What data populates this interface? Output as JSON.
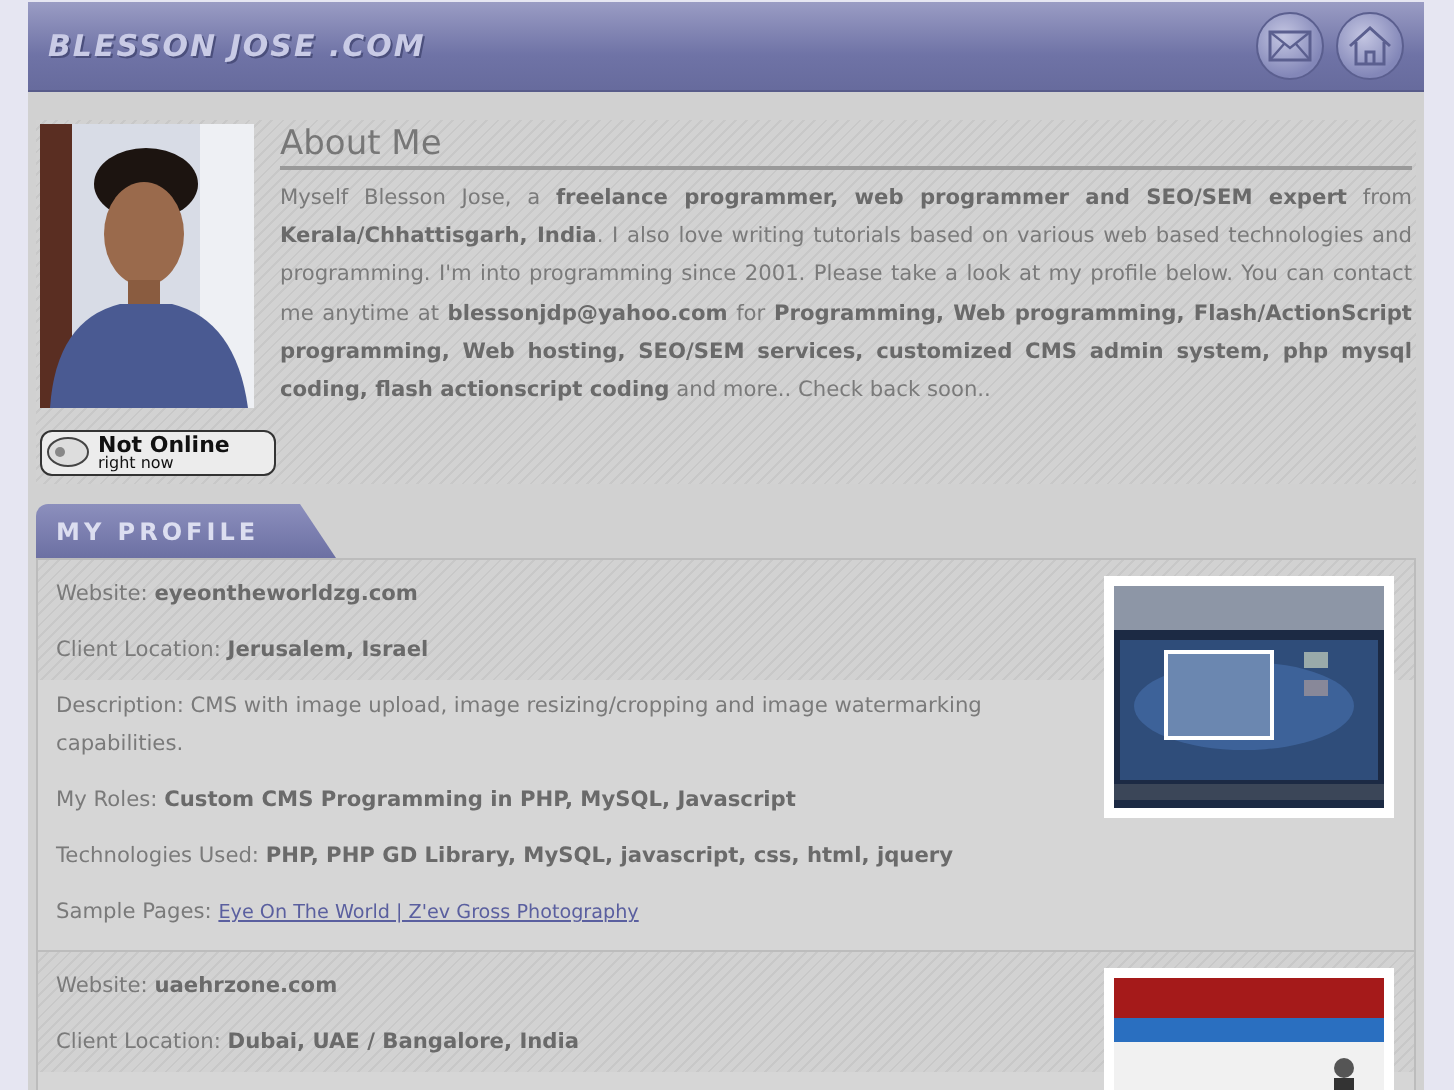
{
  "header": {
    "logo": "BLESSON JOSE .COM",
    "buttons": [
      {
        "kind": "mail"
      },
      {
        "kind": "home"
      }
    ]
  },
  "about": {
    "status": {
      "title": "Not Online",
      "subtitle": "right now"
    },
    "title": "About Me",
    "text": "Myself Blesson Jose, a **freelance programmer, web programmer and SEO/SEM expert** from **Kerala/Chhattisgarh, India**. I also love writing tutorials based on various web based technologies and programming. I'm into programming since 2001. Please take a look at my profile below. You can contact me anytime at **blessonjdp@yahoo.com** for **Programming, Web programming, Flash/ActionScript programming, Web hosting, SEO/SEM services, customized CMS admin system, php mysql coding, flash actionscript coding** and more.. Check back soon.."
  },
  "profile": {
    "title": "MY PROFILE",
    "projects": [
      {
        "rows": [
          {
            "label": "Website:",
            "value": "eyeontheworldzg.com"
          },
          {
            "label": "Client Location:",
            "value": "Jerusalem, Israel"
          },
          {
            "label": "Description:",
            "text": "CMS with image upload, image resizing/cropping and image watermarking capabilities."
          },
          {
            "label": "My Roles:",
            "value": "Custom CMS Programming in PHP, MySQL, Javascript"
          },
          {
            "label": "Technologies Used:",
            "value": "PHP, PHP GD Library, MySQL, javascript, css, html, jquery"
          },
          {
            "label": "Sample Pages:",
            "link": "Eye On The World | Z'ev Gross Photography"
          }
        ]
      },
      {
        "rows": [
          {
            "label": "Website:",
            "value": "uaehrzone.com"
          },
          {
            "label": "Client Location:",
            "value": "Dubai, UAE / Bangalore, India"
          }
        ]
      }
    ]
  }
}
